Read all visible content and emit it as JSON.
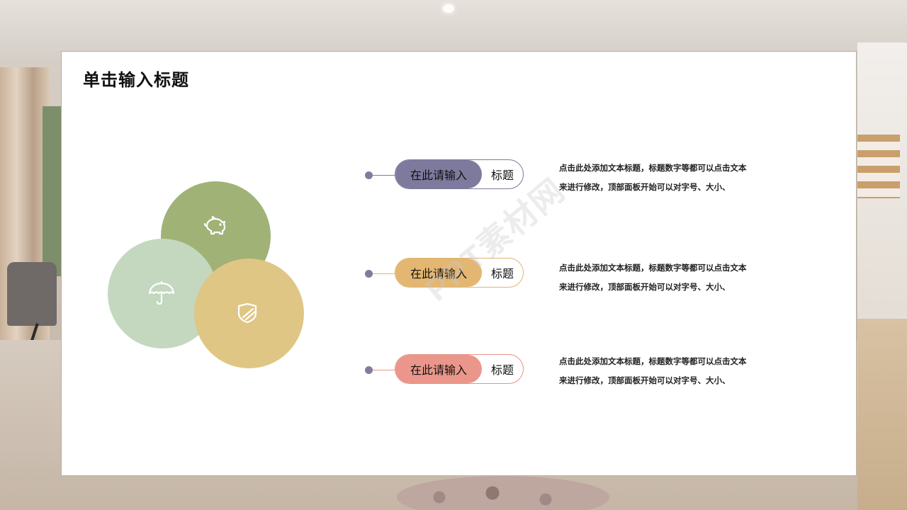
{
  "slide": {
    "title": "单击输入标题"
  },
  "circles": [
    {
      "name": "green",
      "color": "#a0b275",
      "icon": "piggy-bank-icon"
    },
    {
      "name": "sage",
      "color": "#c3d8bf",
      "icon": "umbrella-icon"
    },
    {
      "name": "gold",
      "color": "#dfc685",
      "icon": "shield-icon"
    }
  ],
  "items": [
    {
      "tag": "在此请输入",
      "sub": "标题",
      "color": "#7d7a9e",
      "desc_line1": "点击此处添加文本标题，标题数字等都可以点击文本",
      "desc_line2": "来进行修改，顶部面板开始可以对字号、大小、"
    },
    {
      "tag": "在此请输入",
      "sub": "标题",
      "color": "#e3b671",
      "desc_line1": "点击此处添加文本标题，标题数字等都可以点击文本",
      "desc_line2": "来进行修改，顶部面板开始可以对字号、大小、"
    },
    {
      "tag": "在此请输入",
      "sub": "标题",
      "color": "#eb968a",
      "desc_line1": "点击此处添加文本标题，标题数字等都可以点击文本",
      "desc_line2": "来进行修改，顶部面板开始可以对字号、大小、"
    }
  ],
  "watermark": "PPT素材网"
}
